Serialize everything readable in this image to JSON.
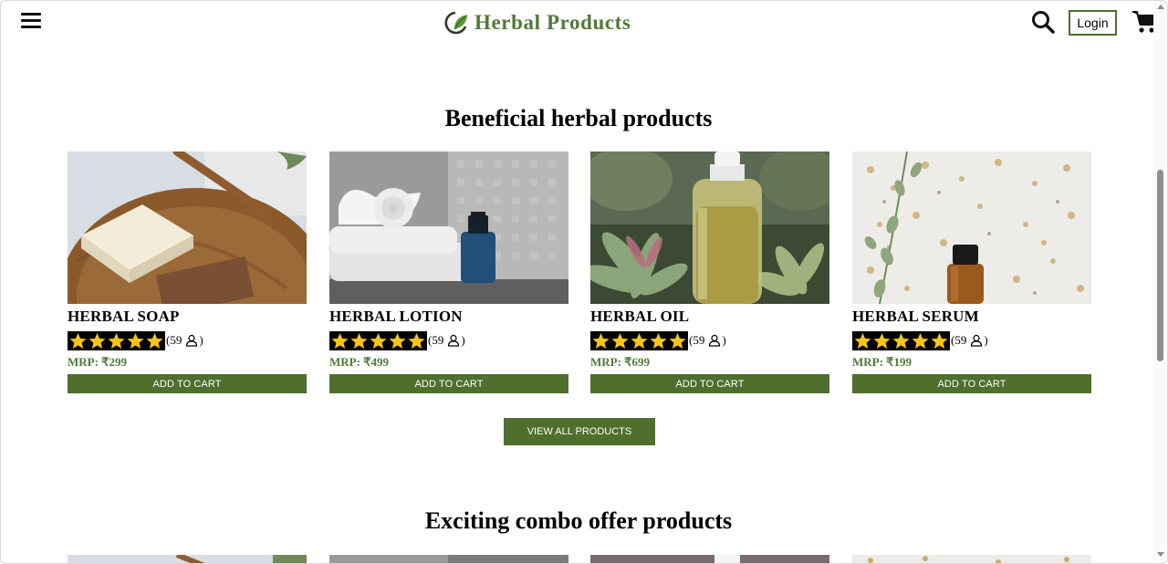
{
  "header": {
    "brand_name": "Herbal Products",
    "login_label": "Login"
  },
  "sections": [
    {
      "title": "Beneficial herbal products"
    },
    {
      "title": "Exciting combo offer products"
    }
  ],
  "products": [
    {
      "name": "HERBAL SOAP",
      "rating": 5,
      "review_count": "(59",
      "review_close": ")",
      "price": "MRP: ₹299",
      "button": "ADD TO CART"
    },
    {
      "name": "HERBAL LOTION",
      "rating": 5,
      "review_count": "(59",
      "review_close": ")",
      "price": "MRP: ₹499",
      "button": "ADD TO CART"
    },
    {
      "name": "HERBAL OIL",
      "rating": 5,
      "review_count": "(59",
      "review_close": ")",
      "price": "MRP: ₹699",
      "button": "ADD TO CART"
    },
    {
      "name": "HERBAL SERUM",
      "rating": 5,
      "review_count": "(59",
      "review_close": ")",
      "price": "MRP: ₹199",
      "button": "ADD TO CART"
    }
  ],
  "view_all_label": "VIEW ALL PRODUCTS",
  "colors": {
    "brand_green": "#4f7a36",
    "button_green": "#4f6f2c",
    "star_yellow": "#f5c518"
  },
  "icons": [
    "menu-icon",
    "leaf-logo-icon",
    "search-icon",
    "cart-icon",
    "star-icon",
    "user-icon"
  ]
}
